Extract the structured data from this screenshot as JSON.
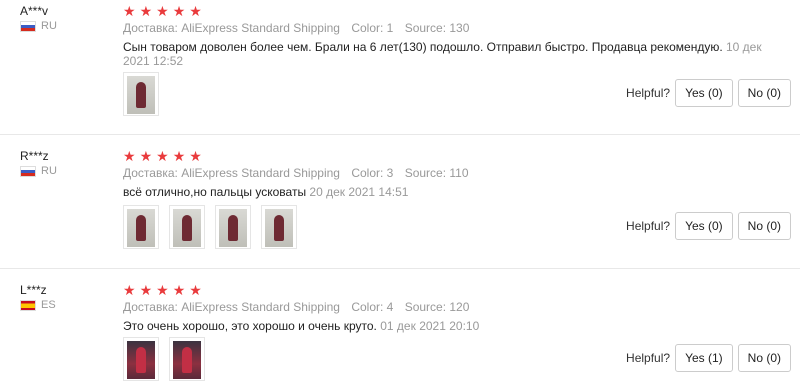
{
  "reviews": [
    {
      "user": "A***v",
      "country_code": "RU",
      "flag": "flag-ru",
      "rating": 5,
      "shipping": "Доставка: AliExpress Standard Shipping",
      "color": "Color: 1",
      "source": "Source: 130",
      "text": "Сын товаром доволен более чем. Брали на 6 лет(130) подошло. Отправил быстро. Продавца рекомендую.",
      "date": "10 дек 2021 12:52",
      "photos": 1,
      "photo_style": "light",
      "helpful_label": "Helpful?",
      "yes_label": "Yes (0)",
      "no_label": "No (0)"
    },
    {
      "user": "R***z",
      "country_code": "RU",
      "flag": "flag-ru",
      "rating": 5,
      "shipping": "Доставка: AliExpress Standard Shipping",
      "color": "Color: 3",
      "source": "Source: 110",
      "text": "всё отлично,но пальцы усковаты",
      "date": "20 дек 2021 14:51",
      "photos": 4,
      "photo_style": "light",
      "helpful_label": "Helpful?",
      "yes_label": "Yes (0)",
      "no_label": "No (0)"
    },
    {
      "user": "L***z",
      "country_code": "ES",
      "flag": "flag-es",
      "rating": 5,
      "shipping": "Доставка: AliExpress Standard Shipping",
      "color": "Color: 4",
      "source": "Source: 120",
      "text": "Это очень хорошо, это хорошо и очень круто.",
      "date": "01 дек 2021 20:10",
      "photos": 2,
      "photo_style": "dark",
      "helpful_label": "Helpful?",
      "yes_label": "Yes (1)",
      "no_label": "No (0)"
    }
  ],
  "colors": {
    "star": "#e93b3d",
    "muted": "#999999",
    "divider": "#e8e8e8"
  },
  "icons": {
    "star": "star-icon",
    "flag": "country-flag-icon",
    "photo": "review-photo"
  }
}
